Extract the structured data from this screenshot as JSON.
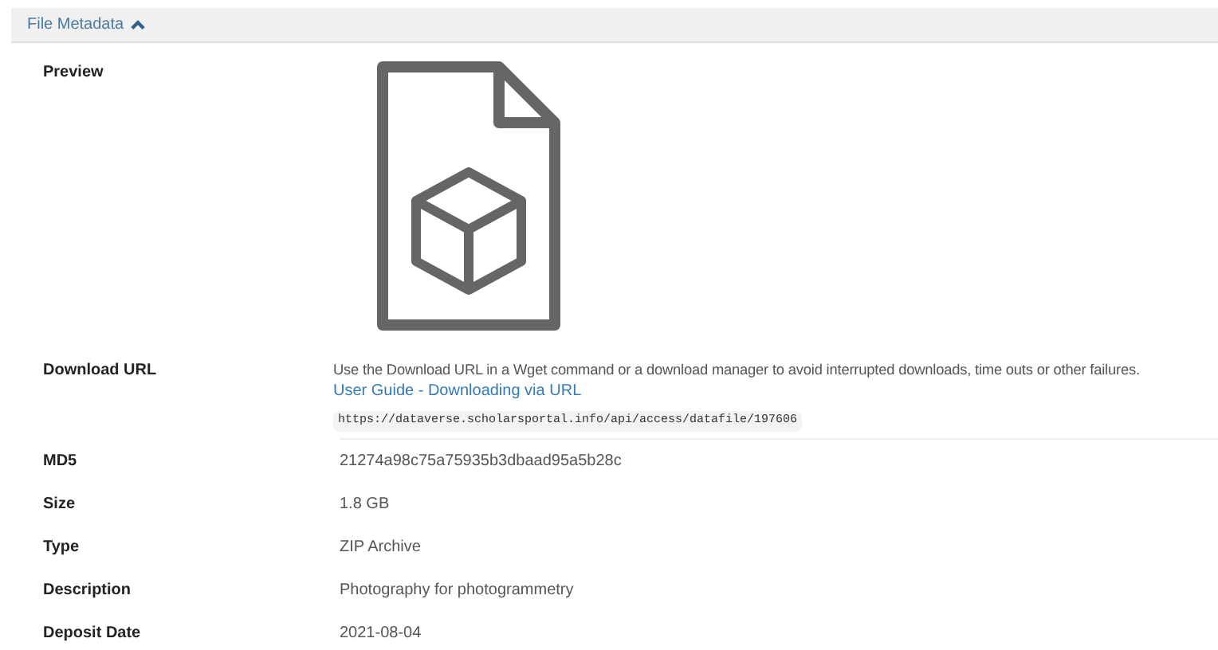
{
  "panel": {
    "title": "File Metadata",
    "expanded": true
  },
  "preview": {
    "label": "Preview"
  },
  "download": {
    "label": "Download URL",
    "note": "Use the Download URL in a Wget command or a download manager to avoid interrupted downloads, time outs or other failures.",
    "links": [
      "User Guide - Downloading via URL"
    ],
    "url": "https://dataverse.scholarsportal.info/api/access/datafile/197606"
  },
  "fields": [
    {
      "label": "MD5",
      "value": "21274a98c75a75935b3dbaad95a5b28c"
    },
    {
      "label": "Size",
      "value": "1.8 GB"
    },
    {
      "label": "Type",
      "value": "ZIP Archive"
    },
    {
      "label": "Description",
      "value": "Photography for photogrammetry"
    },
    {
      "label": "Deposit Date",
      "value": "2021-08-04"
    }
  ]
}
